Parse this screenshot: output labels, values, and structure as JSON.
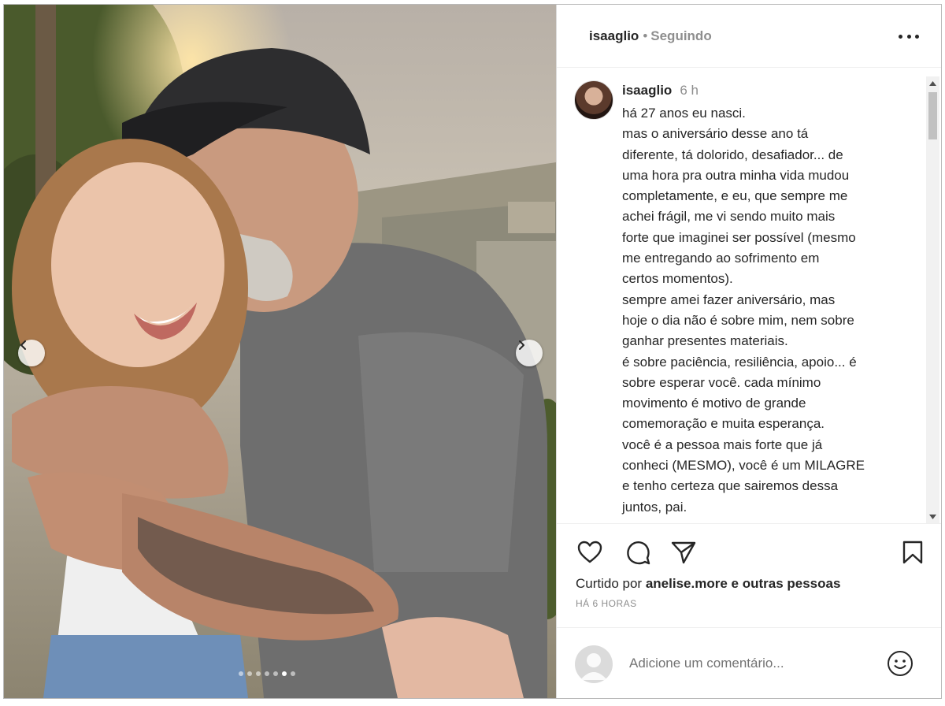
{
  "post": {
    "username": "isaaglio",
    "separator": "•",
    "follow_status": "Seguindo",
    "more_icon": "more-horizontal-icon",
    "image_alt": "Foto: pai beijando a filha sorridente",
    "slides_total": 7,
    "slide_active": 6
  },
  "caption": {
    "username": "isaaglio",
    "time": "6 h",
    "lines": [
      "há 27 anos eu nasci.",
      "mas o aniversário desse ano tá",
      "diferente, tá dolorido, desafiador... de",
      "uma hora pra outra minha vida mudou",
      "completamente, e eu, que sempre me",
      "achei frágil, me vi sendo muito mais",
      "forte que imaginei ser possível (mesmo",
      "me entregando ao sofrimento em",
      "certos momentos).",
      "sempre amei fazer aniversário, mas",
      "hoje o dia não é sobre mim, nem sobre",
      "ganhar presentes materiais.",
      "é sobre paciência, resiliência, apoio... é",
      "sobre esperar você. cada mínimo",
      "movimento é motivo de grande",
      "comemoração e muita esperança.",
      "você é a pessoa mais forte que já",
      "conheci (MESMO), você é um MILAGRE",
      "e tenho certeza que sairemos dessa",
      "juntos, pai."
    ]
  },
  "actions": {
    "like_icon": "heart-icon",
    "comment_icon": "comment-icon",
    "share_icon": "send-icon",
    "save_icon": "bookmark-icon"
  },
  "likes": {
    "prefix": "Curtido por",
    "user": "anelise.more",
    "suffix": "e outras pessoas"
  },
  "timestamp": "HÁ 6 HORAS",
  "comment": {
    "placeholder": "Adicione um comentário...",
    "emoji_icon": "smiley-icon"
  },
  "colors": {
    "text": "#262626",
    "muted": "#8e8e8e",
    "divider": "#efefef"
  }
}
